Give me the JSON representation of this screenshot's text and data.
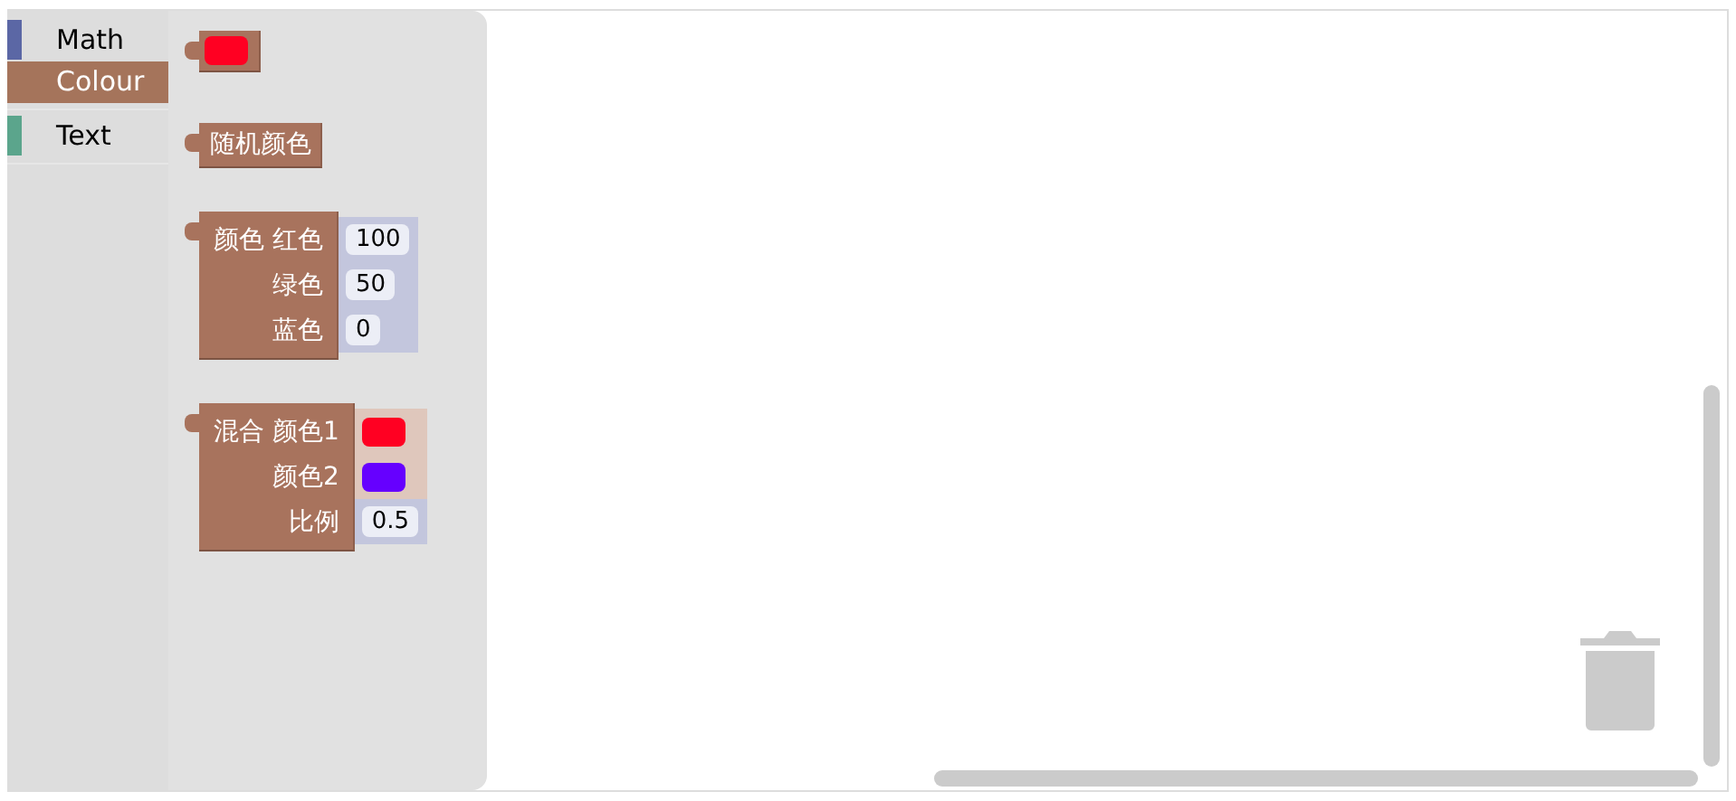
{
  "toolbox": {
    "categories": [
      {
        "label": "Math",
        "color": "#5b67a5",
        "selected": false
      },
      {
        "label": "Colour",
        "color": "#a5745b",
        "selected": true
      },
      {
        "label": "Text",
        "color": "#5ba58c",
        "selected": false
      }
    ]
  },
  "flyout": {
    "blocks": [
      {
        "kind": "picker",
        "color": "#ff0022"
      },
      {
        "kind": "random",
        "label": "随机颜色"
      },
      {
        "kind": "inputs",
        "rows": [
          {
            "label": "颜色 红色",
            "kind": "number",
            "value": "100"
          },
          {
            "label": "绿色",
            "kind": "number",
            "value": "50"
          },
          {
            "label": "蓝色",
            "kind": "number",
            "value": "0"
          }
        ]
      },
      {
        "kind": "inputs",
        "rows": [
          {
            "label": "混合 颜色1",
            "kind": "colour",
            "color": "#ff0022"
          },
          {
            "label": "颜色2",
            "kind": "colour",
            "color": "#6600ff"
          },
          {
            "label": "比例",
            "kind": "number",
            "value": "0.5"
          }
        ]
      }
    ]
  }
}
